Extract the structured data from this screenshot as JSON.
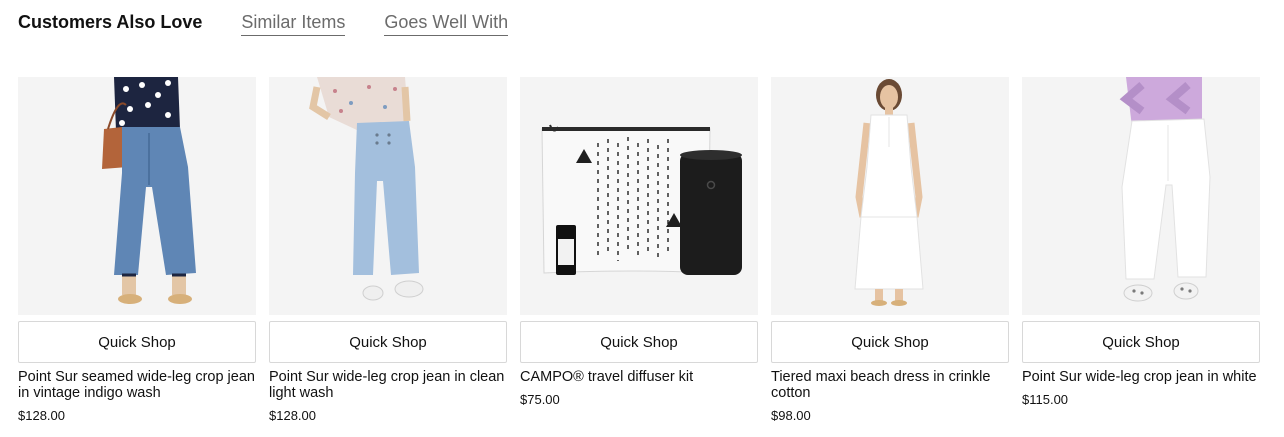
{
  "tabs": {
    "customers_also_love": "Customers Also Love",
    "similar_items": "Similar Items",
    "goes_well_with": "Goes Well With"
  },
  "products": [
    {
      "quick_shop": "Quick Shop",
      "name": "Point Sur seamed wide-leg crop jean in vintage indigo wash",
      "price": "$128.00",
      "image": "model-wearing-indigo-wide-leg-jeans"
    },
    {
      "quick_shop": "Quick Shop",
      "name": "Point Sur wide-leg crop jean in clean light wash",
      "price": "$128.00",
      "image": "model-wearing-light-wash-wide-leg-jeans"
    },
    {
      "quick_shop": "Quick Shop",
      "name": "CAMPO® travel diffuser kit",
      "price": "$75.00",
      "image": "travel-diffuser-kit-pouch-and-diffuser"
    },
    {
      "quick_shop": "Quick Shop",
      "name": "Tiered maxi beach dress in crinkle cotton",
      "price": "$98.00",
      "image": "model-wearing-white-maxi-dress"
    },
    {
      "quick_shop": "Quick Shop",
      "name": "Point Sur wide-leg crop jean in white",
      "price": "$115.00",
      "image": "model-wearing-white-wide-leg-jeans"
    }
  ],
  "colors": {
    "image_background": "#f4f4f4",
    "inactive_tab": "#6b6b6b",
    "text": "#111111",
    "button_border": "#d8d8d8"
  }
}
